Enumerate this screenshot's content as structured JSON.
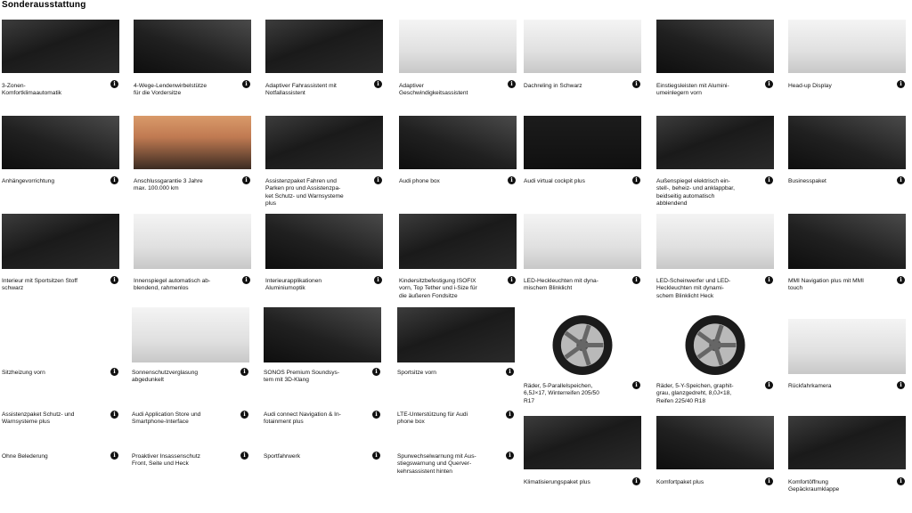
{
  "page_title": "Sonderausstattung",
  "info_glyph": "i",
  "items": [
    {
      "label": "3-Zonen-\nKomfortklimaautomatik",
      "icon": "climate-console-photo",
      "style": "dark"
    },
    {
      "label": "4-Wege-Lendenwirbelstütze\nfür die Vordersitze",
      "icon": "seat-photo",
      "style": "dark2"
    },
    {
      "label": "Adaptiver Fahrassistent mit\nNotfallassistent",
      "icon": "steering-wheel-photo",
      "style": "dark"
    },
    {
      "label": "Adaptiver\nGeschwindigkeitsassistent",
      "icon": "traffic-topview-photo",
      "style": "light"
    },
    {
      "label": "Dachreling in Schwarz",
      "icon": "roof-rail-photo",
      "style": "light"
    },
    {
      "label": "Einstiegsleisten mit Alumini-\numeinlegern vorn",
      "icon": "door-sill-photo",
      "style": "dark2"
    },
    {
      "label": "Head-up Display",
      "icon": "head-up-display-photo",
      "style": "light"
    },
    {
      "label": "Anhängevorrichtung",
      "icon": "towbar-photo",
      "style": "dark2"
    },
    {
      "label": "Anschlussgarantie 3 Jahre\nmax. 100.000 km",
      "icon": "warranty-lifestyle-photo",
      "style": "sunset"
    },
    {
      "label": "Assistenzpaket Fahren und\nParken pro und Assistenzpa-\nket Schutz- und Warnsysteme\nplus",
      "icon": "assist-package-photo",
      "style": "dark"
    },
    {
      "label": "Audi phone box",
      "icon": "phone-box-photo",
      "style": "dark2"
    },
    {
      "label": "Audi virtual cockpit plus",
      "icon": "virtual-cockpit-photo",
      "style": "display"
    },
    {
      "label": "Außenspiegel elektrisch ein-\nstell-, beheiz- und anklappbar,\nbeidseitig automatisch\nabblendend",
      "icon": "mirror-switch-photo",
      "style": "dark"
    },
    {
      "label": "Businesspaket",
      "icon": "business-package-photo",
      "style": "dark2"
    },
    {
      "label": "Interieur mit Sportsitzen Stoff\nschwarz",
      "icon": "interior-seats-photo",
      "style": "dark"
    },
    {
      "label": "Innenspiegel automatisch ab-\nblendend, rahmenlos",
      "icon": "rearview-mirror-photo",
      "style": "light"
    },
    {
      "label": "Interieurapplikationen\nAluminiumoptik",
      "icon": "interior-trim-photo",
      "style": "dark2"
    },
    {
      "label": "Kindersitzbefestigung ISOFIX\nvorn, Top Tether und i-Size für\ndie äußeren Fondsitze",
      "icon": "isofix-photo",
      "style": "dark"
    },
    {
      "label": "LED-Heckleuchten mit dyna-\nmischem Blinklicht",
      "icon": "tail-light-photo",
      "style": "light"
    },
    {
      "label": "LED-Scheinwerfer und LED-\nHeckleuchten mit dynami-\nschem Blinklicht Heck",
      "icon": "headlight-photo",
      "style": "light"
    },
    {
      "label": "MMI Navigation plus mit MMI\ntouch",
      "icon": "navigation-screen-photo",
      "style": "dark2"
    },
    {
      "label": "Sitzheizung vorn",
      "icon": "seat-heating-photo",
      "style": "white"
    },
    {
      "label": "Sonnenschutzverglasung\nabgedunkelt",
      "icon": "tinted-glass-photo",
      "style": "light"
    },
    {
      "label": "SONOS Premium Soundsys-\ntem mit 3D-Klang",
      "icon": "speaker-photo",
      "style": "dark2"
    },
    {
      "label": "Sportsitze vorn",
      "icon": "sport-seats-photo",
      "style": "dark"
    },
    {
      "label": "Räder, 5-Parallelspeichen,\n6,5J×17, Winterreifen 205/50\nR17",
      "icon": "wheel-5-parallel-spoke-photo",
      "style": "white"
    },
    {
      "label": "Räder, 5-Y-Speichen, graphit-\ngrau, glanzgedreht, 8,0J×18,\nReifen 225/40 R18",
      "icon": "wheel-5-y-spoke-photo",
      "style": "white"
    },
    {
      "label": "Rückfahrkamera",
      "icon": "rear-camera-photo",
      "style": "light"
    },
    {
      "label": "Assistenzpaket Schutz- und\nWarnsysteme plus",
      "icon": "",
      "style": "none"
    },
    {
      "label": "Audi Application Store und\nSmartphone-Interface",
      "icon": "",
      "style": "none"
    },
    {
      "label": "Audi connect Navigation & In-\nfotainment plus",
      "icon": "",
      "style": "none"
    },
    {
      "label": "LTE-Unterstützung für Audi\nphone box",
      "icon": "",
      "style": "none"
    },
    {
      "label": "Ohne Belederung",
      "icon": "",
      "style": "none"
    },
    {
      "label": "Proaktiver Insassenschutz\nFront, Seite und Heck",
      "icon": "",
      "style": "none"
    },
    {
      "label": "Sportfahrwerk",
      "icon": "",
      "style": "none"
    },
    {
      "label": "Spurwechselwarnung mit Aus-\nstiegswarnung und Querver-\nkehrsassistent hinten",
      "icon": "",
      "style": "none"
    },
    {
      "label": "Klimatisierungspaket plus",
      "icon": "climate-package-photo",
      "style": "dark"
    },
    {
      "label": "Komfortpaket plus",
      "icon": "comfort-package-photo",
      "style": "dark2"
    },
    {
      "label": "Komfortöffnung\nGepäckraumklappe",
      "icon": "tailgate-photo",
      "style": "dark"
    }
  ]
}
